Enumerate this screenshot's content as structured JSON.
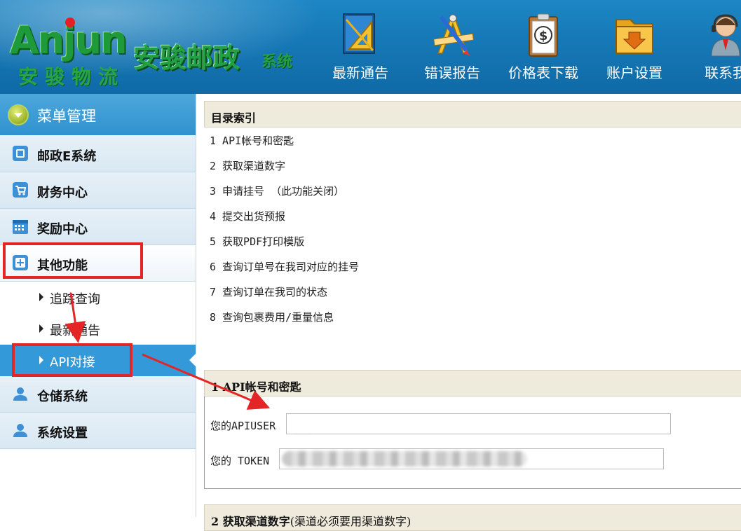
{
  "header": {
    "logo_word": "Anjun",
    "logo_cn": "安骏物流",
    "title": "安骏邮政",
    "title_suffix": "系统",
    "brand_colors": {
      "header_blue": "#1678b6",
      "logo_green": "#23a045",
      "logo_dot": "#e61f25"
    },
    "nav": [
      {
        "label": "最新通告",
        "icon": "triangle-ruler-icon"
      },
      {
        "label": "错误报告",
        "icon": "drafting-tools-icon"
      },
      {
        "label": "价格表下载",
        "icon": "price-clipboard-icon"
      },
      {
        "label": "账户设置",
        "icon": "folder-download-icon"
      },
      {
        "label": "联系我",
        "icon": "support-agent-icon"
      }
    ]
  },
  "sidebar": {
    "menu_title": "菜单管理",
    "items": [
      {
        "label": "邮政E系统",
        "icon": "window-icon"
      },
      {
        "label": "财务中心",
        "icon": "cart-icon"
      },
      {
        "label": "奖励中心",
        "icon": "calendar-icon"
      },
      {
        "label": "其他功能",
        "icon": "plus-box-icon"
      }
    ],
    "sub_items": [
      {
        "label": "追踪查询"
      },
      {
        "label": "最新通告"
      },
      {
        "label": "API对接",
        "active": true
      }
    ],
    "items_after": [
      {
        "label": "仓储系统",
        "icon": "user-icon"
      },
      {
        "label": "系统设置",
        "icon": "user-icon"
      }
    ]
  },
  "main": {
    "toc_title": "目录索引",
    "toc": [
      "1 API帐号和密匙",
      "2 获取渠道数字",
      "3 申请挂号 （此功能关闭）",
      "4 提交出货预报",
      "5 获取PDF打印模版",
      "6 查询订单号在我司对应的挂号",
      "7 查询订单在我司的状态",
      "8 查询包裹费用/重量信息"
    ],
    "section1": {
      "title": "1 API帐号和密匙",
      "apiuser_label": "您的APIUSER",
      "token_label": "您的 TOKEN"
    },
    "section2": {
      "title": "2 获取渠道数字",
      "note": "(渠道必须要用渠道数字)"
    }
  },
  "annotation_color": "#e32525"
}
